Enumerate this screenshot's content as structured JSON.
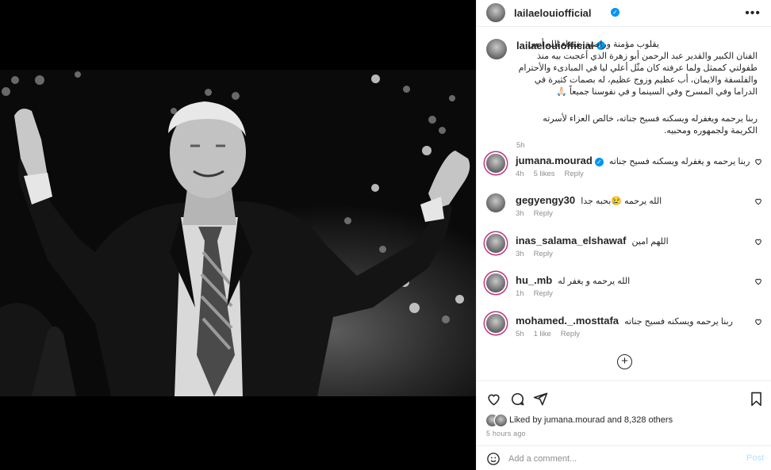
{
  "post": {
    "username": "lailaelouiofficial",
    "caption": "يقلوب مؤمنة وراضية بقضاء الله أنعي الفنان الكبير والقدير عبد الرحمن أبو زهرة الذي أعجبت بيه منذ طفولتي كممثل ولما عرفته كان مثّل أعلي ليا في المبادىء والأحترام والفلسفة والايمان، أب عظيم وزوج عظيم، له بصمات كثيرة في الدراما وفي المسرح وفي السينما و في نفوسنا جميعاً 🙏🏻",
    "caption2": "ربنا يرحمه ويغفرله ويسكنه فسيح جناته، خالص العزاء لأسرته الكريمة ولجمهوره ومحبيه.",
    "caption_time": "5h",
    "likes_text": "Liked by jumana.mourad and 8,328 others",
    "timestamp": "5 hours ago"
  },
  "comments": [
    {
      "user": "jumana.mourad",
      "verified": true,
      "text": "ربنا يرحمه و يغفرله ويسكنه فسيح جناته",
      "time": "4h",
      "likes": "5 likes",
      "reply": "Reply"
    },
    {
      "user": "gegyengy30",
      "verified": false,
      "text": "الله يرحمه 😢بحبه جدا",
      "time": "3h",
      "likes": "",
      "reply": "Reply"
    },
    {
      "user": "inas_salama_elshawaf",
      "verified": false,
      "text": "اللهم امين",
      "time": "3h",
      "likes": "",
      "reply": "Reply"
    },
    {
      "user": "hu_.mb",
      "verified": false,
      "text": "الله يرحمه و يغفر له",
      "time": "1h",
      "likes": "",
      "reply": "Reply"
    },
    {
      "user": "mohamed._.mosttafa",
      "verified": false,
      "text": "ربنا يرحمه ويسكنه فسيح جناته",
      "time": "5h",
      "likes": "1 like",
      "reply": "Reply"
    }
  ],
  "add_comment": {
    "placeholder": "Add a comment...",
    "post_label": "Post"
  },
  "icons": {
    "more": "more-options-icon",
    "verified": "verified-badge-icon",
    "like": "heart-icon",
    "comment": "comment-icon",
    "share": "share-icon",
    "save": "bookmark-icon",
    "emoji": "emoji-icon",
    "load_more": "plus-circle-icon"
  },
  "colors": {
    "verified": "#0095f6",
    "post_button": "#b2dffc",
    "meta": "#8e8e8e"
  }
}
